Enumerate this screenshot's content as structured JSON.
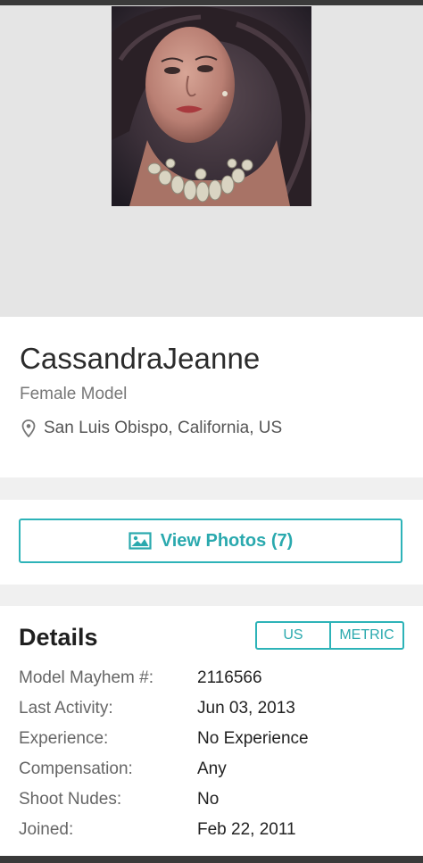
{
  "profile": {
    "name": "CassandraJeanne",
    "role": "Female Model",
    "location": "San Luis Obispo, California, US"
  },
  "photos_button": {
    "label": "View Photos (7)"
  },
  "details": {
    "title": "Details",
    "unit_us": "US",
    "unit_metric": "METRIC",
    "rows": [
      {
        "label": "Model Mayhem #:",
        "value": "2116566"
      },
      {
        "label": "Last Activity:",
        "value": "Jun 03, 2013"
      },
      {
        "label": "Experience:",
        "value": "No Experience"
      },
      {
        "label": "Compensation:",
        "value": "Any"
      },
      {
        "label": "Shoot Nudes:",
        "value": "No"
      },
      {
        "label": "Joined:",
        "value": "Feb 22, 2011"
      }
    ]
  },
  "colors": {
    "accent": "#2db3b8",
    "hero_bg": "#e5e5e5"
  },
  "icons": [
    "map-pin-icon",
    "image-icon"
  ]
}
